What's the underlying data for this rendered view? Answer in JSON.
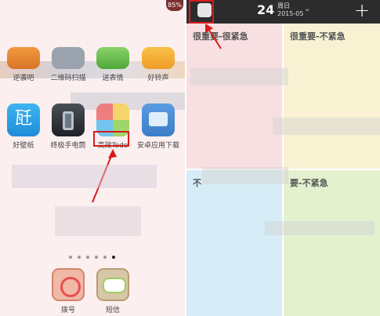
{
  "status": {
    "battery": "85%"
  },
  "home": {
    "apps_row1": [
      {
        "name": "reverse",
        "label": "逆袭吧"
      },
      {
        "name": "qr",
        "label": "二维码扫描"
      },
      {
        "name": "face",
        "label": "送表情"
      },
      {
        "name": "music",
        "label": "好铃声"
      }
    ],
    "apps_row2": [
      {
        "name": "wallpaper",
        "label": "好壁纸"
      },
      {
        "name": "torch",
        "label": "终极手电筒"
      },
      {
        "name": "todo",
        "label": "高效Todo"
      },
      {
        "name": "store",
        "label": "安卓应用下载"
      }
    ],
    "dock": [
      {
        "name": "dialer",
        "label": "拨号"
      },
      {
        "name": "sms",
        "label": "短信"
      }
    ],
    "wallpaper_glyph": "瓩"
  },
  "todo_app": {
    "day": "24",
    "weekday": "周日",
    "year_month": "2015-05",
    "chevron": "⌄",
    "add": "+",
    "quadrants": [
      {
        "title": "很重要-很紧急",
        "color": "#f8dfe1"
      },
      {
        "title": "很重要-不紧急",
        "color": "#f8f2d3"
      },
      {
        "title": "不",
        "color": "#d6ecf6"
      },
      {
        "title": "要-不紧急",
        "color": "#e4f1cf"
      }
    ]
  },
  "colors": {
    "highlight": "#d81c1c"
  }
}
